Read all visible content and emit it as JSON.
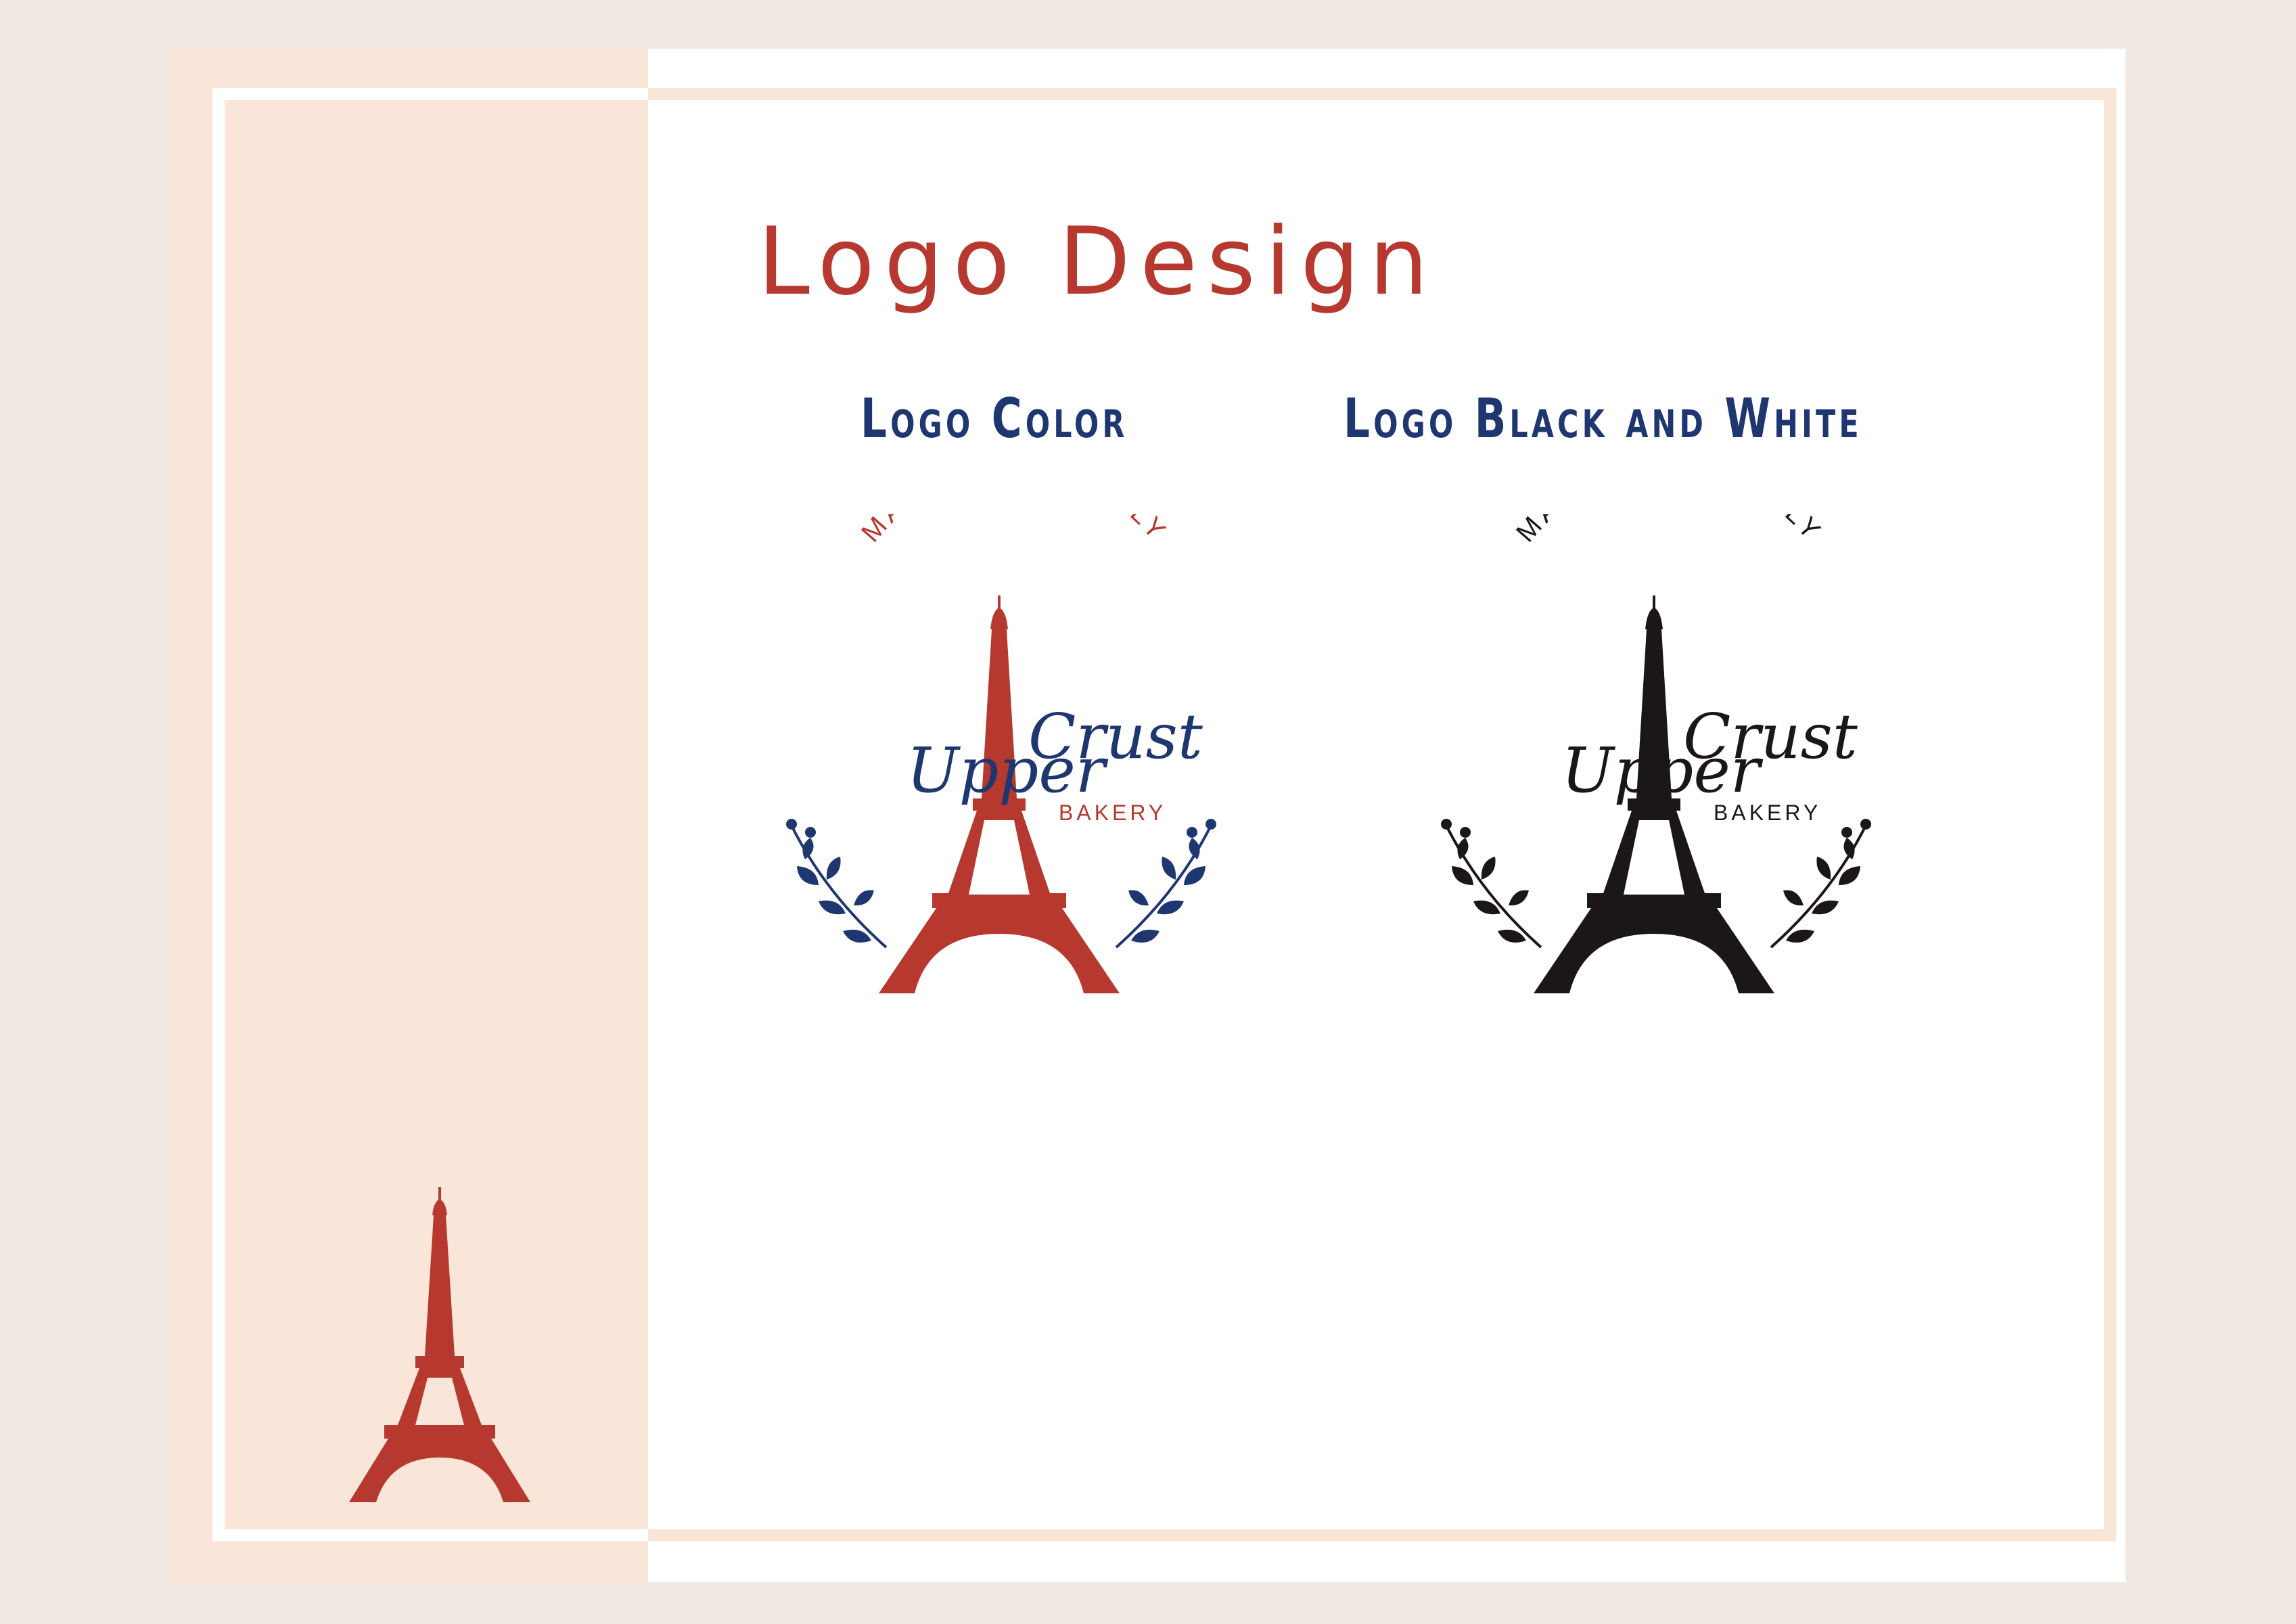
{
  "page": {
    "title": "Logo Design",
    "subtitles": {
      "color": "Logo Color",
      "bw": "Logo Black and White"
    }
  },
  "logo": {
    "arc_text": "MADE FRESH DAILY",
    "brand_left": "Upper",
    "brand_right": "Crust",
    "tagline": "BAKERY"
  },
  "colors": {
    "red": "#b6382e",
    "navy": "#1f3770",
    "black": "#1c1717",
    "peach": "#f9e6d8",
    "background": "#f1e8e2"
  },
  "icons": [
    "eiffel-tower-icon",
    "laurel-branch-icon"
  ]
}
